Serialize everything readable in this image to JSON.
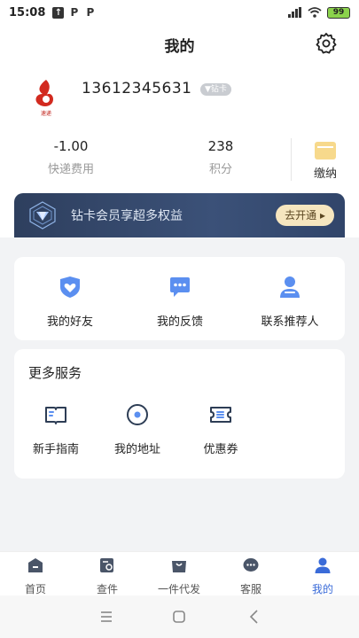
{
  "status": {
    "time": "15:08",
    "battery": "99"
  },
  "page": {
    "title": "我的"
  },
  "profile": {
    "phone": "13612345631",
    "badge": "▼钻卡"
  },
  "stats": {
    "fee_value": "-1.00",
    "fee_label": "快递费用",
    "points_value": "238",
    "points_label": "积分",
    "pay_label": "缴纳"
  },
  "vip": {
    "text": "钻卡会员享超多权益",
    "button": "去开通 ▸"
  },
  "quick": [
    {
      "label": "我的好友",
      "icon": "heart-shield-icon"
    },
    {
      "label": "我的反馈",
      "icon": "chat-bubble-icon"
    },
    {
      "label": "联系推荐人",
      "icon": "contact-person-icon"
    }
  ],
  "services": {
    "title": "更多服务",
    "items": [
      {
        "label": "新手指南",
        "icon": "guide-book-icon"
      },
      {
        "label": "我的地址",
        "icon": "location-pin-icon"
      },
      {
        "label": "优惠券",
        "icon": "coupon-icon"
      }
    ]
  },
  "tabs": [
    {
      "label": "首页",
      "icon": "home-icon"
    },
    {
      "label": "查件",
      "icon": "search-package-icon"
    },
    {
      "label": "一件代发",
      "icon": "bag-icon"
    },
    {
      "label": "客服",
      "icon": "customer-service-icon"
    },
    {
      "label": "我的",
      "icon": "user-icon"
    }
  ],
  "colors": {
    "accent": "#3a6bd8",
    "icon_blue": "#5b8ff0",
    "vip_bg": "#33476b",
    "vip_button": "#f6e6bf"
  }
}
